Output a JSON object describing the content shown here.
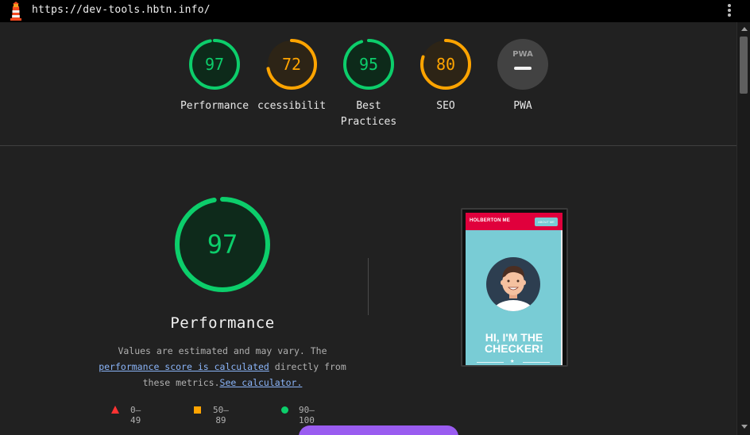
{
  "topbar": {
    "url": "https://dev-tools.hbtn.info/",
    "logo_icon": "lighthouse-icon",
    "menu_icon": "kebab-menu-icon"
  },
  "colors": {
    "pass": "#0cce6b",
    "average": "#ffa400",
    "fail": "#ff3333",
    "na": "#9e9e9e",
    "background": "#212121"
  },
  "gauges": [
    {
      "score": "97",
      "label": "Performance",
      "status": "pass"
    },
    {
      "score": "72",
      "label": "ccessibilit",
      "status": "average"
    },
    {
      "score": "95",
      "label_line1": "Best",
      "label_line2": "Practices",
      "status": "pass"
    },
    {
      "score": "80",
      "label": "SEO",
      "status": "average"
    },
    {
      "score": "PWA",
      "label": "PWA",
      "status": "na"
    }
  ],
  "performance": {
    "score": "97",
    "title": "Performance",
    "desc_prefix": "Values are estimated and may vary. The",
    "desc_link1": "performance score is calculated",
    "desc_middle": " directly from",
    "desc_suffix": "these metrics.",
    "desc_link2": "See calculator."
  },
  "legend": {
    "fail": "0–49",
    "average": "50–89",
    "pass": "90–100"
  },
  "thumbnail": {
    "brand": "HOLBERTON ME",
    "button": "ABOUT ME",
    "headline_line1": "HI, I'M THE",
    "headline_line2": "CHECKER!"
  }
}
